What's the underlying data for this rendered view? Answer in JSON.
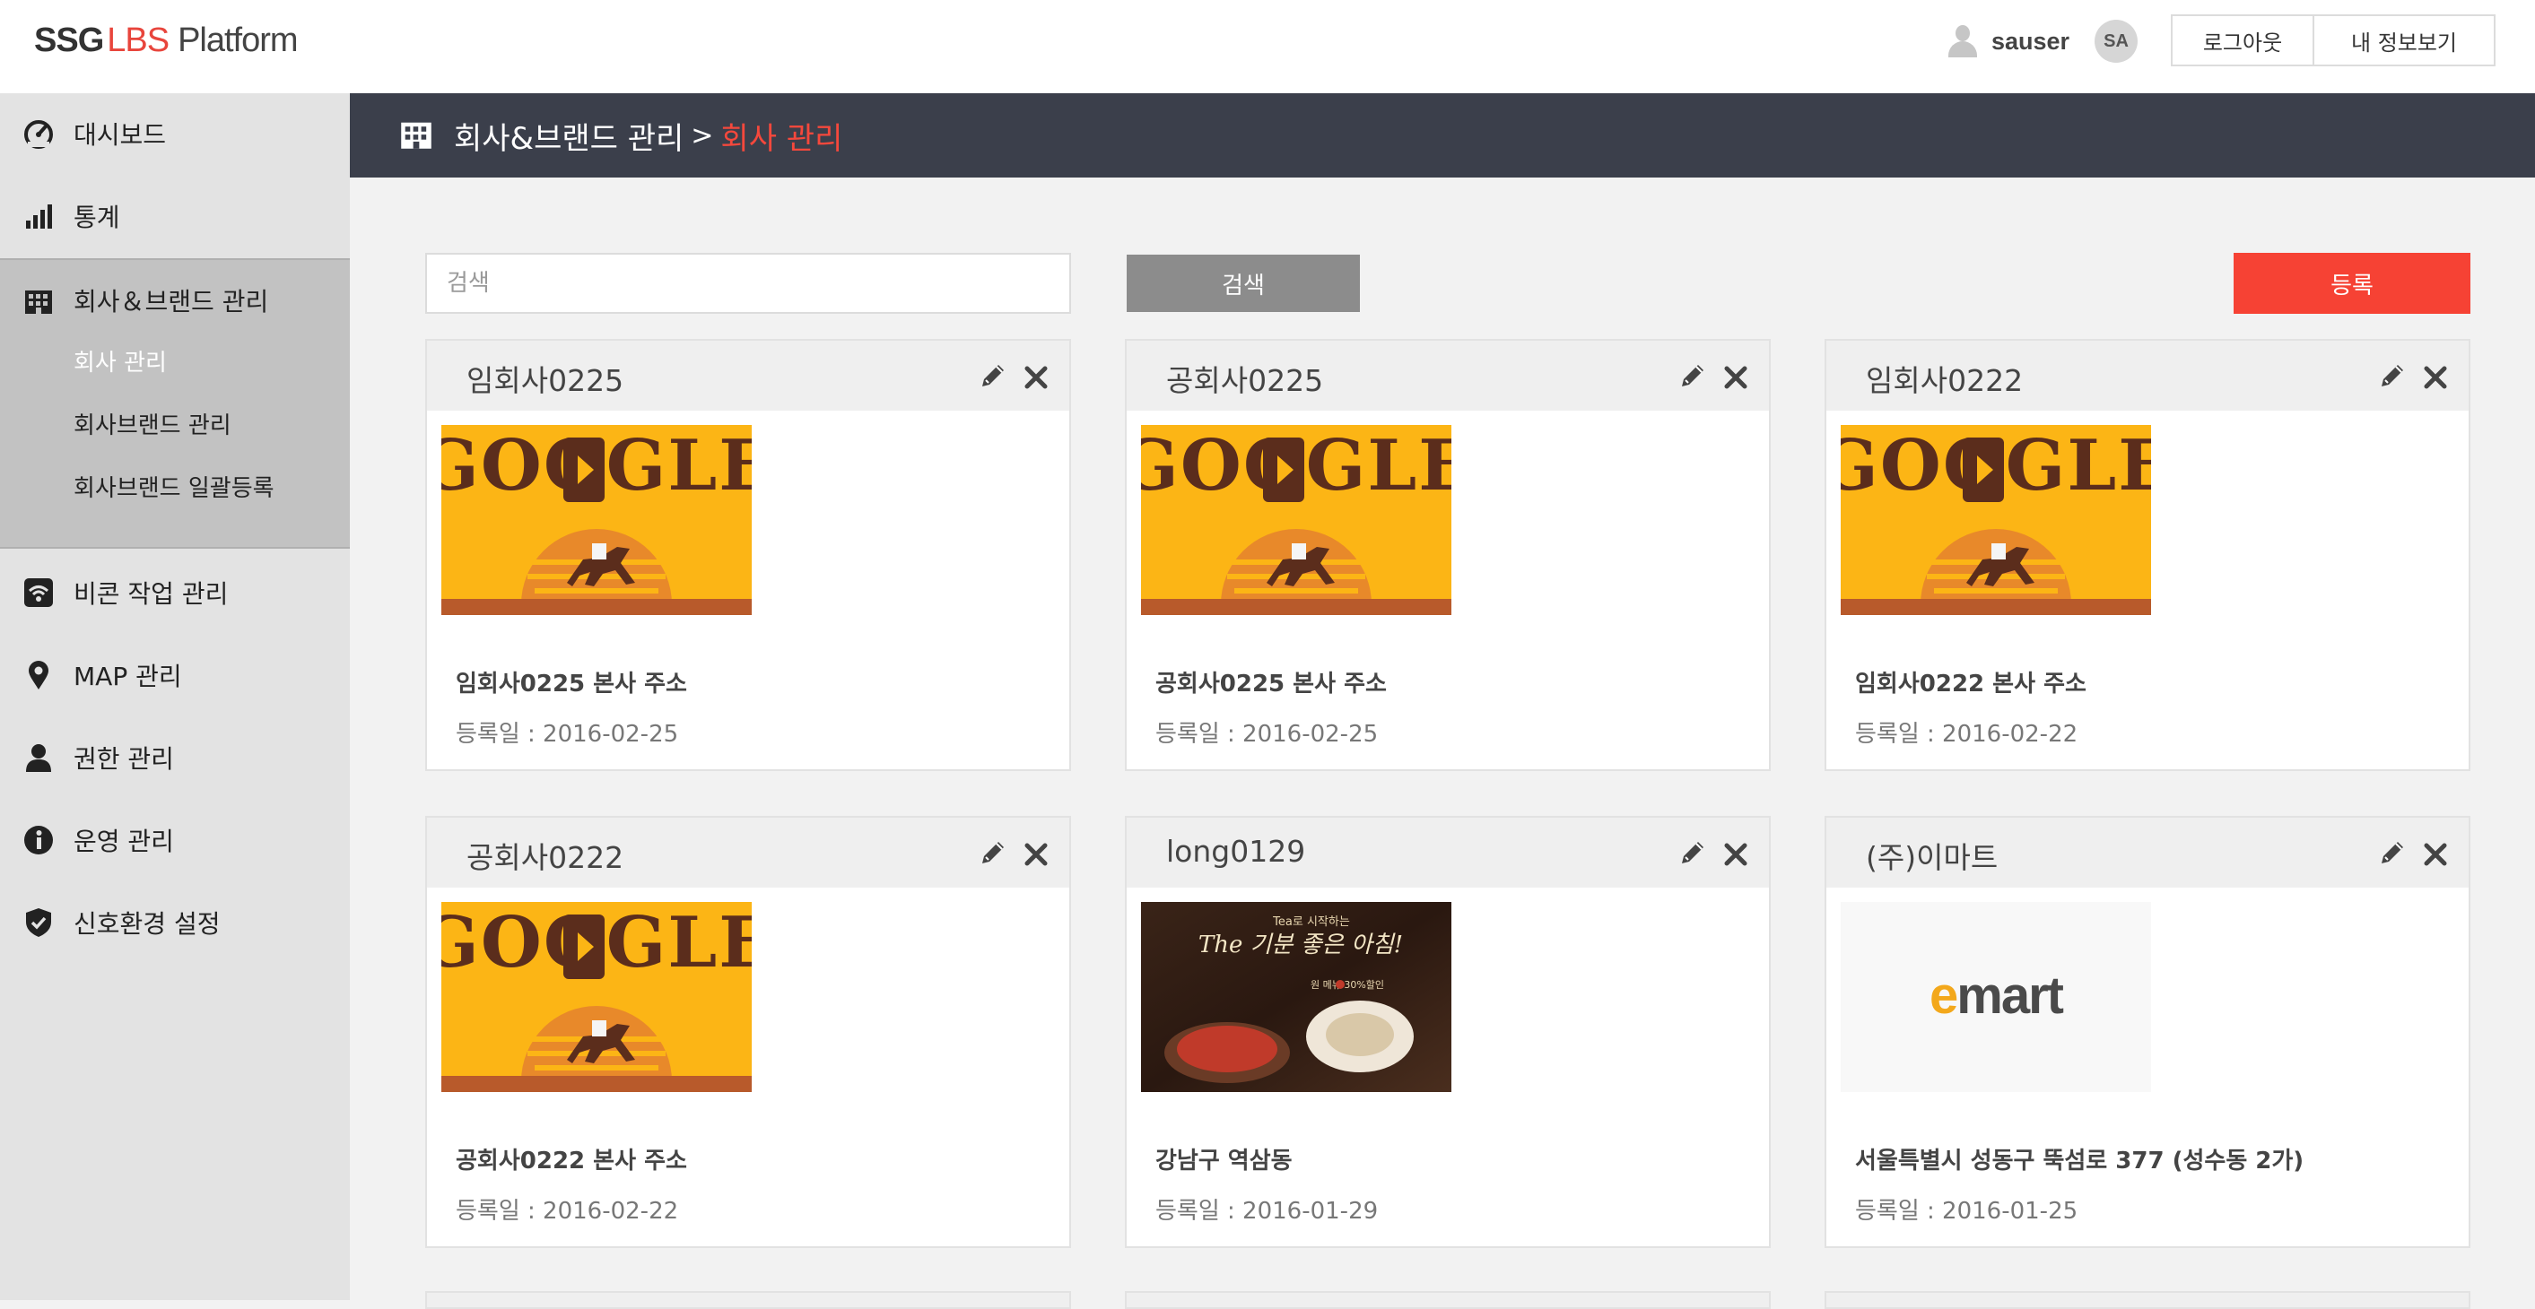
{
  "header": {
    "logo_ssg": "SSG",
    "logo_lbs": "LBS",
    "logo_platform": "Platform",
    "username": "sauser",
    "avatar_initials": "SA",
    "logout_label": "로그아웃",
    "myinfo_label": "내 정보보기"
  },
  "sidebar": {
    "items": [
      {
        "label": "대시보드",
        "icon": "dashboard-icon"
      },
      {
        "label": "통계",
        "icon": "bar-chart-icon"
      },
      {
        "label": "회사＆브랜드 관리",
        "icon": "building-icon"
      },
      {
        "label": "비콘 작업 관리",
        "icon": "wifi-icon"
      },
      {
        "label": "MAP 관리",
        "icon": "map-pin-icon"
      },
      {
        "label": "권한 관리",
        "icon": "user-icon"
      },
      {
        "label": "운영 관리",
        "icon": "info-icon"
      },
      {
        "label": "신호환경 설정",
        "icon": "shield-check-icon"
      }
    ],
    "sub_items": [
      {
        "label": "회사 관리",
        "active": true
      },
      {
        "label": "회사브랜드 관리",
        "active": false
      },
      {
        "label": "회사브랜드 일괄등록",
        "active": false
      }
    ]
  },
  "breadcrumb": {
    "parent": "회사&브랜드 관리",
    "separator": ">",
    "current": "회사 관리",
    "current_color": "#f5483c"
  },
  "search": {
    "placeholder": "검색",
    "value": "",
    "button_label": "검색",
    "register_label": "등록"
  },
  "colors": {
    "accent": "#f64234",
    "header_bar": "#3b3f4b",
    "sidebar_bg": "#e3e3e3",
    "sidebar_active_group": "#c2c2c2"
  },
  "companies": [
    {
      "name": "임회사0225",
      "image": "google-doodle",
      "address": "임회사0225 본사 주소",
      "date": "등록일 : 2016-02-25"
    },
    {
      "name": "공회사0225",
      "image": "google-doodle",
      "address": "공회사0225 본사 주소",
      "date": "등록일 : 2016-02-25"
    },
    {
      "name": "임회사0222",
      "image": "google-doodle",
      "address": "임회사0222 본사 주소",
      "date": "등록일 : 2016-02-22"
    },
    {
      "name": "공회사0222",
      "image": "google-doodle",
      "address": "공회사0222 본사 주소",
      "date": "등록일 : 2016-02-22"
    },
    {
      "name": "long0129",
      "image": "coffee-ad",
      "address": "강남구 역삼동",
      "date": "등록일 : 2016-01-29",
      "ad_text_1": "Tea로 시작하는",
      "ad_text_2": "The 기분 좋은 아침!",
      "ad_text_3": "원 메뉴 30%할인"
    },
    {
      "name": "(주)이마트",
      "image": "emart-logo",
      "address": "서울특별시 성동구 뚝섬로 377 (성수동 2가)",
      "date": "등록일 : 2016-01-25",
      "logo_text": "emart"
    }
  ],
  "google_doodle_text": "GOOGLE"
}
